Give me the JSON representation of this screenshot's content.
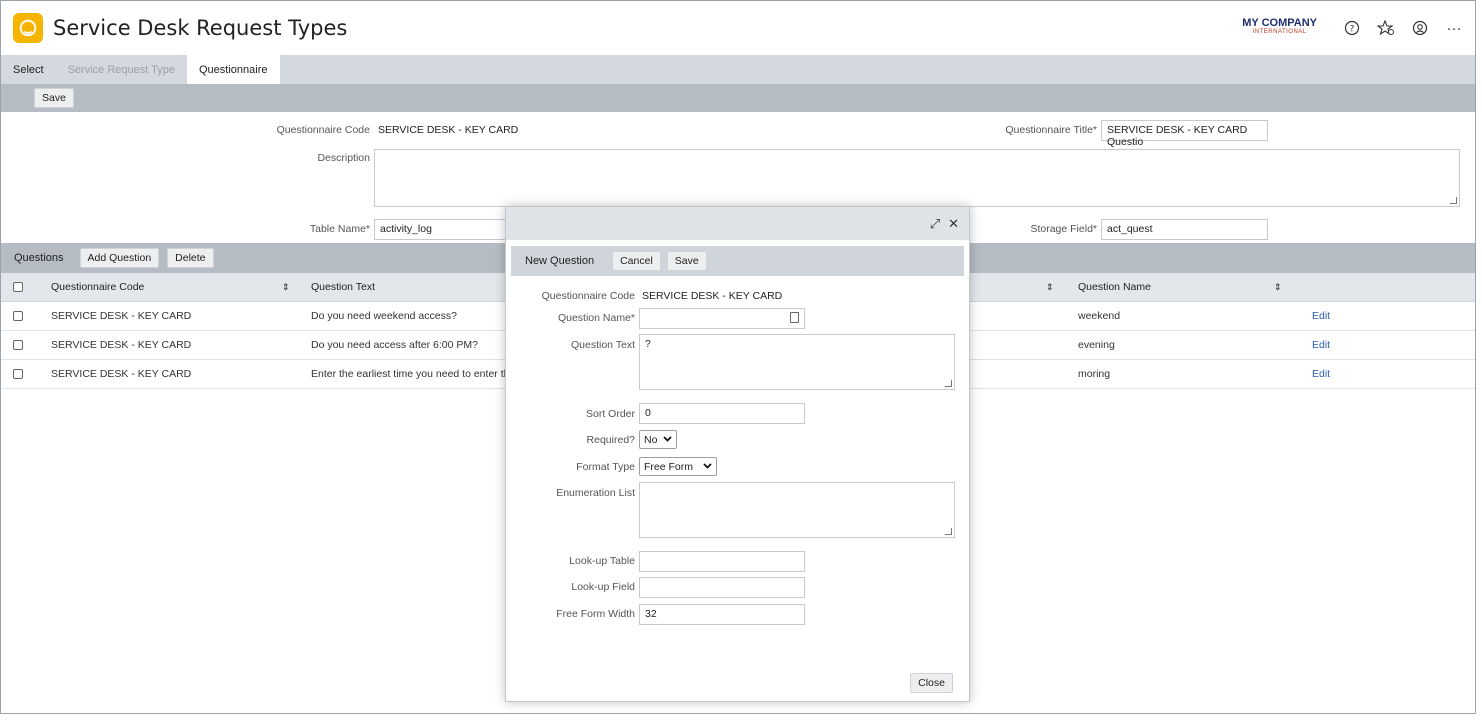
{
  "app": {
    "title": "Service Desk Request Types"
  },
  "header": {
    "company_name": "MY COMPANY",
    "company_sub": "INTERNATIONAL",
    "more": "···"
  },
  "tabs": [
    {
      "label": "Select",
      "state": "normal"
    },
    {
      "label": "Service Request Type",
      "state": "disabled"
    },
    {
      "label": "Questionnaire",
      "state": "active"
    }
  ],
  "toolbar": {
    "save_label": "Save"
  },
  "form": {
    "code_label": "Questionnaire Code",
    "code_value": "SERVICE DESK - KEY CARD",
    "title_label": "Questionnaire Title*",
    "title_value": "SERVICE DESK - KEY CARD Questio",
    "description_label": "Description",
    "table_label": "Table Name*",
    "table_value": "activity_log",
    "storage_label": "Storage Field*",
    "storage_value": "act_quest"
  },
  "questions": {
    "title": "Questions",
    "add_label": "Add Question",
    "delete_label": "Delete",
    "columns": [
      "Questionnaire Code",
      "Question Text",
      "Question Name"
    ],
    "sort_glyph": "⇕",
    "edit_label": "Edit",
    "rows": [
      {
        "code": "SERVICE DESK - KEY CARD",
        "text": "Do you need weekend access?",
        "name": "weekend"
      },
      {
        "code": "SERVICE DESK - KEY CARD",
        "text": "Do you need access after 6:00 PM?",
        "name": "evening"
      },
      {
        "code": "SERVICE DESK - KEY CARD",
        "text": "Enter the earliest time you need to enter the building",
        "name": "moring"
      }
    ]
  },
  "modal": {
    "expand_glyph": "⤢",
    "close_glyph": "✕",
    "title": "New Question",
    "cancel_label": "Cancel",
    "save_label": "Save",
    "close_label": "Close",
    "code_label": "Questionnaire Code",
    "code_value": "SERVICE DESK - KEY CARD",
    "name_label": "Question Name*",
    "name_value": "",
    "text_label": "Question Text",
    "text_value": "?",
    "sort_label": "Sort Order",
    "sort_value": "0",
    "required_label": "Required?",
    "required_value": "No",
    "format_label": "Format Type",
    "format_value": "Free Form",
    "enum_label": "Enumeration List",
    "lookup_table_label": "Look-up Table",
    "lookup_field_label": "Look-up Field",
    "width_label": "Free Form Width",
    "width_value": "32"
  },
  "colors": {
    "accent": "#f5b400",
    "link": "#2a5db0",
    "bar": "#b6bcc4"
  },
  "icons": [
    "help-icon",
    "favorites-icon",
    "user-icon",
    "more-icon",
    "expand-icon",
    "close-icon",
    "calendar-icon"
  ]
}
